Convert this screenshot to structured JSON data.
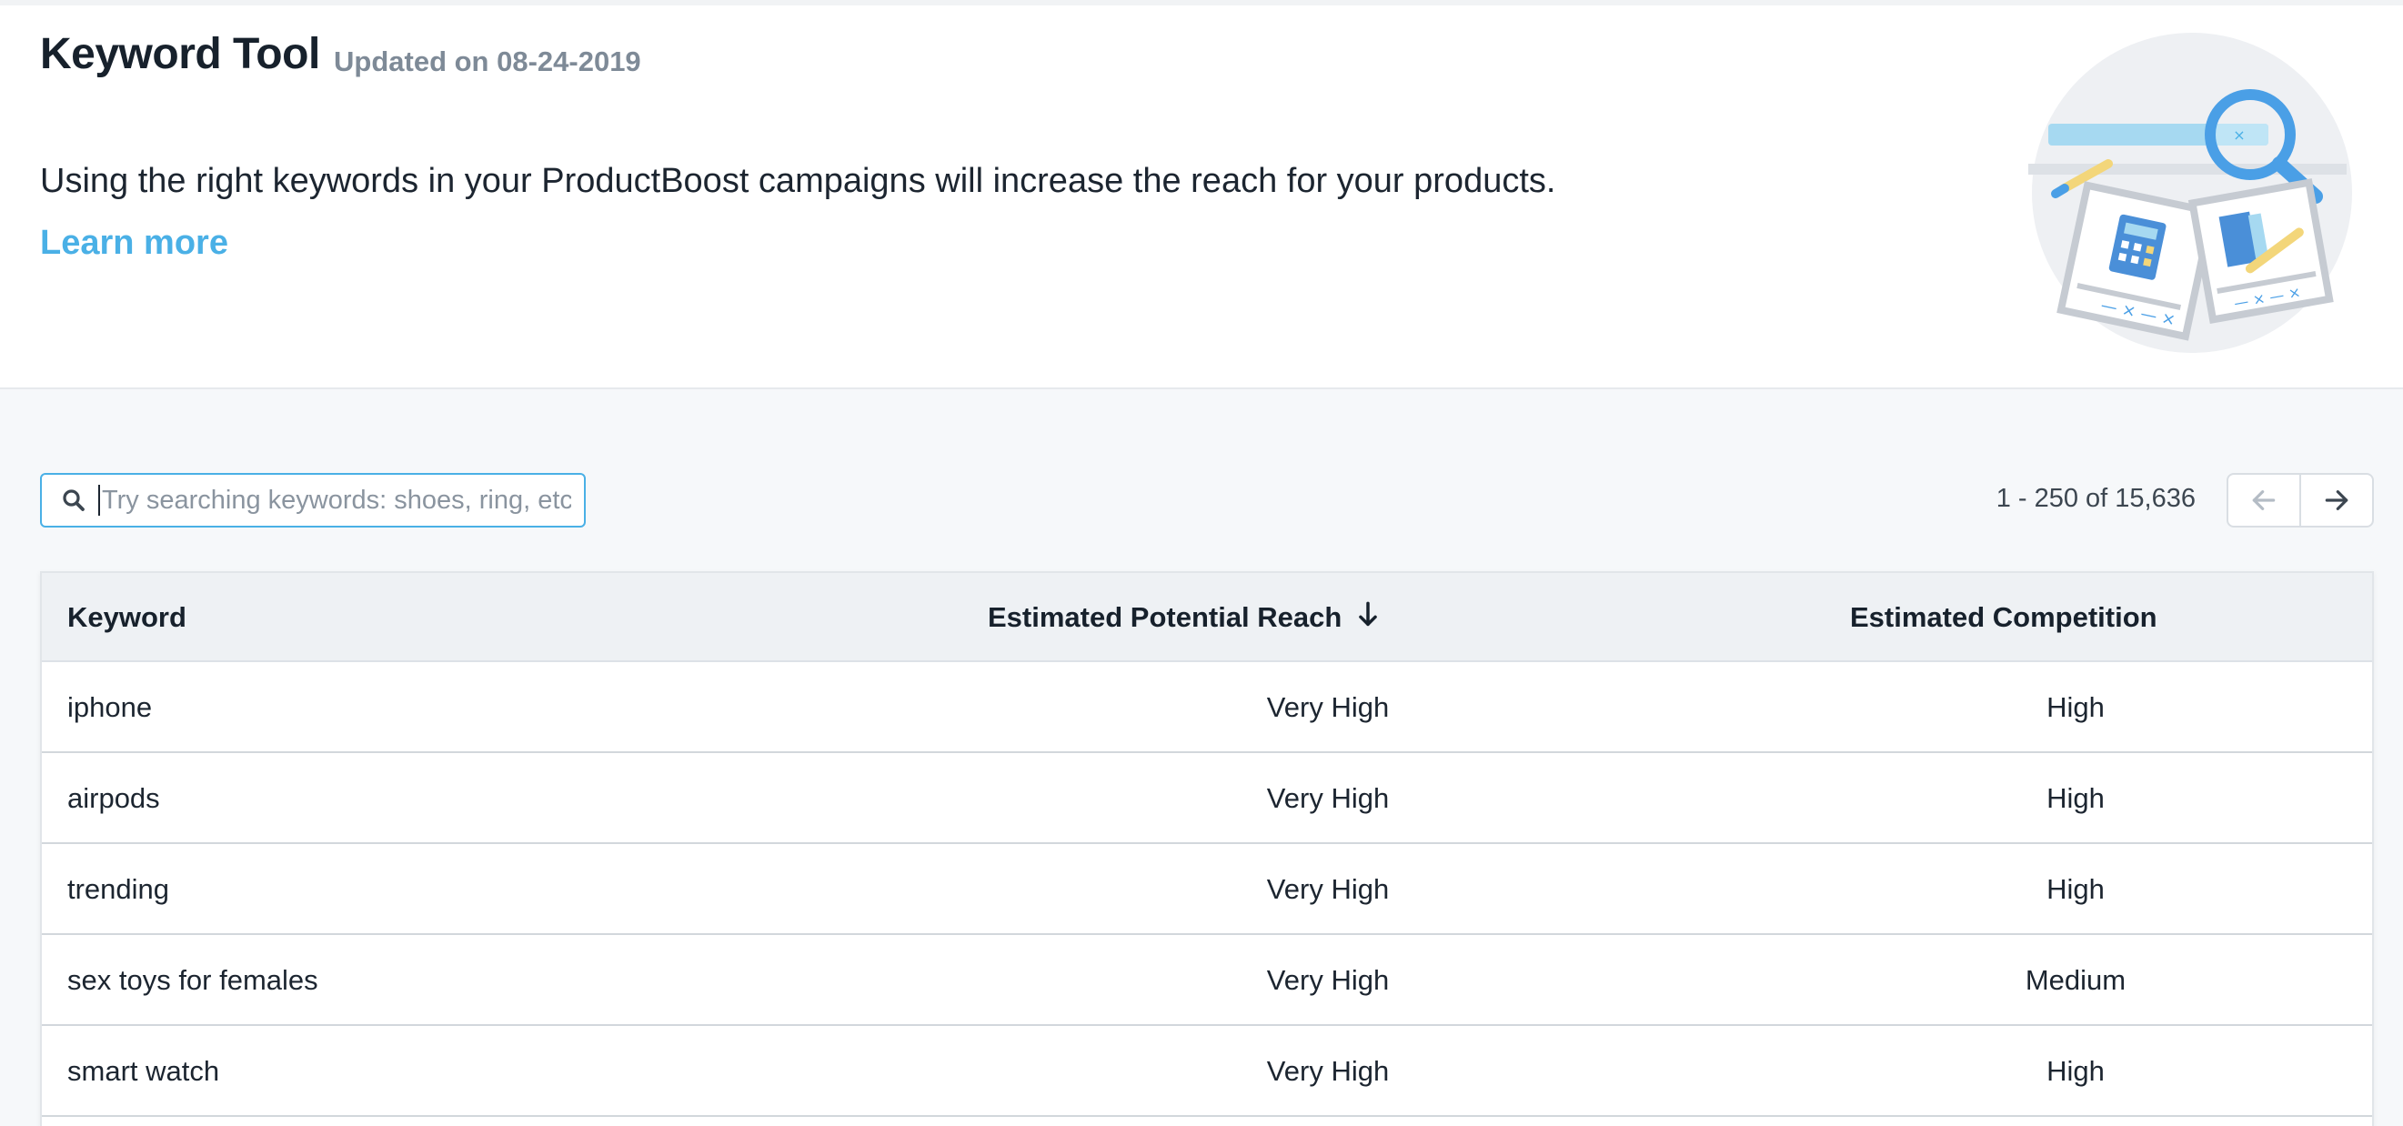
{
  "header": {
    "title": "Keyword Tool",
    "updated": "Updated on 08-24-2019",
    "description": "Using the right keywords in your ProductBoost campaigns will increase the reach for your products.",
    "learn_more": "Learn more",
    "illustration_icon": "keyword-search-illustration"
  },
  "search": {
    "placeholder": "Try searching keywords: shoes, ring, etc.",
    "value": "",
    "icon": "search-icon"
  },
  "pagination": {
    "range_text": "1 - 250 of 15,636",
    "prev_icon": "arrow-left-icon",
    "next_icon": "arrow-right-icon"
  },
  "table": {
    "columns": {
      "keyword": "Keyword",
      "reach": "Estimated Potential Reach",
      "competition": "Estimated Competition"
    },
    "sort_icon": "arrow-down-icon",
    "rows": [
      {
        "keyword": "iphone",
        "reach": "Very High",
        "competition": "High"
      },
      {
        "keyword": "airpods",
        "reach": "Very High",
        "competition": "High"
      },
      {
        "keyword": "trending",
        "reach": "Very High",
        "competition": "High"
      },
      {
        "keyword": "sex toys for females",
        "reach": "Very High",
        "competition": "Medium"
      },
      {
        "keyword": "smart watch",
        "reach": "Very High",
        "competition": "High"
      }
    ]
  },
  "colors": {
    "accent": "#4ab0e6",
    "title": "#17212c",
    "muted": "#7e8a97",
    "table_header_bg": "#eef1f4",
    "page_bg": "#f6f8fa"
  }
}
